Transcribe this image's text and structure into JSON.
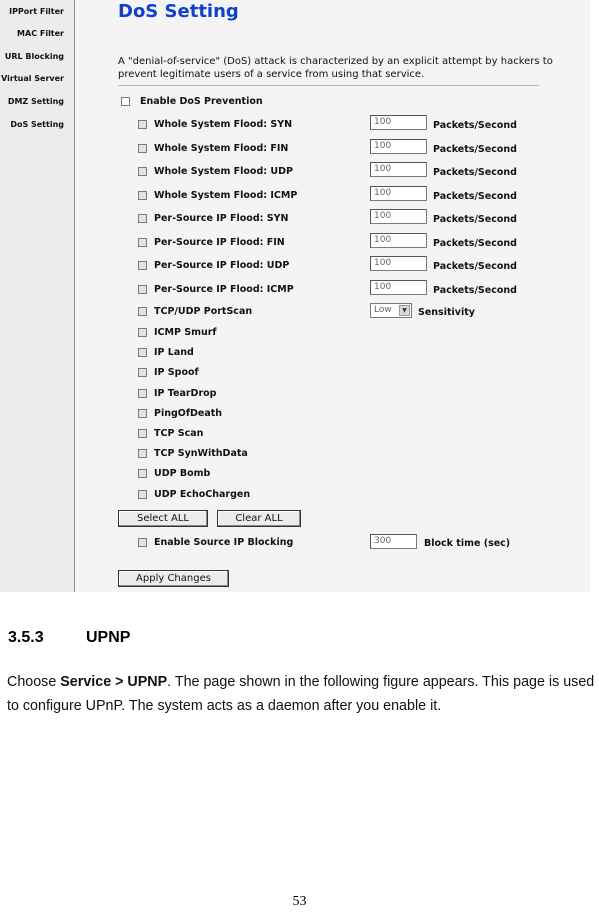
{
  "sidebar": {
    "items": [
      "IPPort Filter",
      "MAC Filter",
      "URL Blocking",
      "Virtual Server",
      "DMZ Setting",
      "DoS Setting"
    ]
  },
  "dos": {
    "title": "DoS Setting",
    "description": "A \"denial-of-service\" (DoS) attack is characterized by an explicit attempt by hackers to prevent legitimate users of a service from using that service.",
    "enable_label": "Enable DoS Prevention",
    "flood_items": [
      {
        "label": "Whole System Flood: SYN",
        "value": "100",
        "unit": "Packets/Second"
      },
      {
        "label": "Whole System Flood: FIN",
        "value": "100",
        "unit": "Packets/Second"
      },
      {
        "label": "Whole System Flood: UDP",
        "value": "100",
        "unit": "Packets/Second"
      },
      {
        "label": "Whole System Flood: ICMP",
        "value": "100",
        "unit": "Packets/Second"
      },
      {
        "label": "Per-Source IP Flood: SYN",
        "value": "100",
        "unit": "Packets/Second"
      },
      {
        "label": "Per-Source IP Flood: FIN",
        "value": "100",
        "unit": "Packets/Second"
      },
      {
        "label": "Per-Source IP Flood: UDP",
        "value": "100",
        "unit": "Packets/Second"
      },
      {
        "label": "Per-Source IP Flood: ICMP",
        "value": "100",
        "unit": "Packets/Second"
      }
    ],
    "portscan": {
      "label": "TCP/UDP PortScan",
      "selected": "Low",
      "unit": "Sensitivity"
    },
    "other_items": [
      "ICMP Smurf",
      "IP Land",
      "IP Spoof",
      "IP TearDrop",
      "PingOfDeath",
      "TCP Scan",
      "TCP SynWithData",
      "UDP Bomb",
      "UDP EchoChargen"
    ],
    "select_all": "Select ALL",
    "clear_all": "Clear ALL",
    "source_block": {
      "label": "Enable Source IP Blocking",
      "value": "300",
      "unit": "Block time (sec)"
    },
    "apply": "Apply Changes"
  },
  "section": {
    "number": "3.5.3",
    "title": "UPNP"
  },
  "paragraph": {
    "prefix": "Choose ",
    "menu_path": "Service > UPNP",
    "suffix": ". The page shown in the following figure appears. This page is used to configure UPnP. The system acts as a daemon after you enable it."
  },
  "page_number": "53"
}
